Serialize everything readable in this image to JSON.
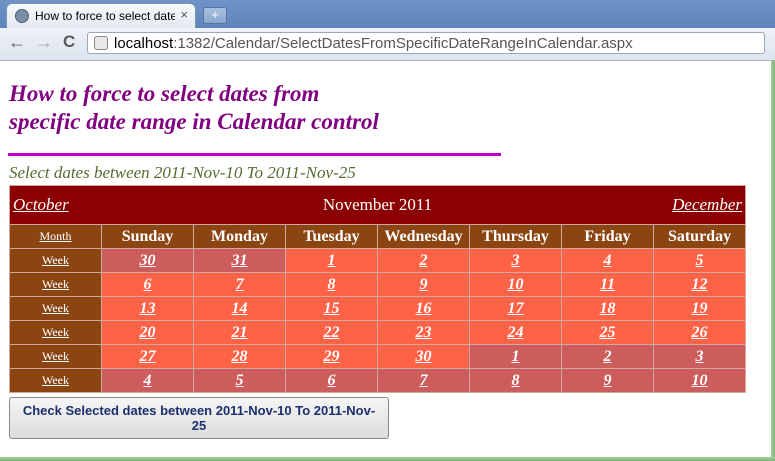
{
  "browser": {
    "tab_title": "How to force to select date",
    "tab_close": "×",
    "new_tab": "+",
    "back": "←",
    "forward": "→",
    "reload": "C",
    "url_host": "localhost",
    "url_path": ":1382/Calendar/SelectDatesFromSpecificDateRangeInCalendar.aspx"
  },
  "page": {
    "heading_line1": "How to force to select dates from",
    "heading_line2": "specific date range in Calendar control",
    "subtitle": "Select dates between 2011-Nov-10 To 2011-Nov-25",
    "button_label": "Check Selected dates between 2011-Nov-10 To 2011-Nov-25"
  },
  "calendar": {
    "prev_month": "October",
    "title": "November 2011",
    "next_month": "December",
    "month_selector": "Month",
    "week_selector": "Week",
    "day_headers": [
      "Sunday",
      "Monday",
      "Tuesday",
      "Wednesday",
      "Thursday",
      "Friday",
      "Saturday"
    ],
    "weeks": [
      [
        "30",
        "31",
        "1",
        "2",
        "3",
        "4",
        "5"
      ],
      [
        "6",
        "7",
        "8",
        "9",
        "10",
        "11",
        "12"
      ],
      [
        "13",
        "14",
        "15",
        "16",
        "17",
        "18",
        "19"
      ],
      [
        "20",
        "21",
        "22",
        "23",
        "24",
        "25",
        "26"
      ],
      [
        "27",
        "28",
        "29",
        "30",
        "1",
        "2",
        "3"
      ],
      [
        "4",
        "5",
        "6",
        "7",
        "8",
        "9",
        "10"
      ]
    ],
    "colors": {
      "title_bg": "#8b0000",
      "header_bg": "#8b4513",
      "day_bg": "#ff6347",
      "other_month_bg": "#cd5c5c"
    }
  }
}
